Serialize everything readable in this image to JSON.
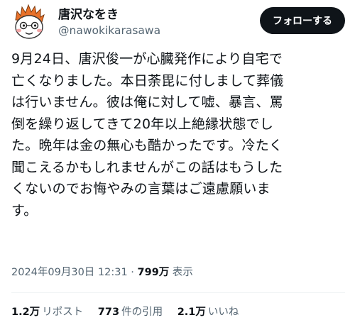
{
  "author": {
    "display_name": "唐沢なをき",
    "handle": "@nawokikarasawa",
    "avatar_icon": "cartoon-face-avatar"
  },
  "follow_button": {
    "label": "フォローする"
  },
  "tweet": {
    "lines": [
      "9月24日、唐沢俊一が心臓発作により自宅で",
      "亡くなりました。本日荼毘に付しまして葬儀",
      "は行いません。彼は俺に対して嘘、暴言、罵",
      "倒を繰り返してきて20年以上絶縁状態でし",
      "た。晩年は金の無心も酷かったです。冷たく",
      "聞こえるかもしれませんがこの話はもうした",
      "くないのでお悔やみの言葉はご遠慮願いま",
      "す。"
    ]
  },
  "meta": {
    "timestamp": "2024年09月30日 12:31",
    "separator": " · ",
    "views_count": "799万",
    "views_label": "表示"
  },
  "stats": {
    "reposts": {
      "count": "1.2万",
      "label": "リポスト"
    },
    "quotes": {
      "count": "773",
      "label": "件の引用"
    },
    "likes": {
      "count": "2.1万",
      "label": "いいね"
    }
  },
  "colors": {
    "text": "#0f1419",
    "secondary": "#536471",
    "button_bg": "#0f1419",
    "avatar_hair": "#e8712a",
    "avatar_cheek": "#f4a6a6"
  }
}
